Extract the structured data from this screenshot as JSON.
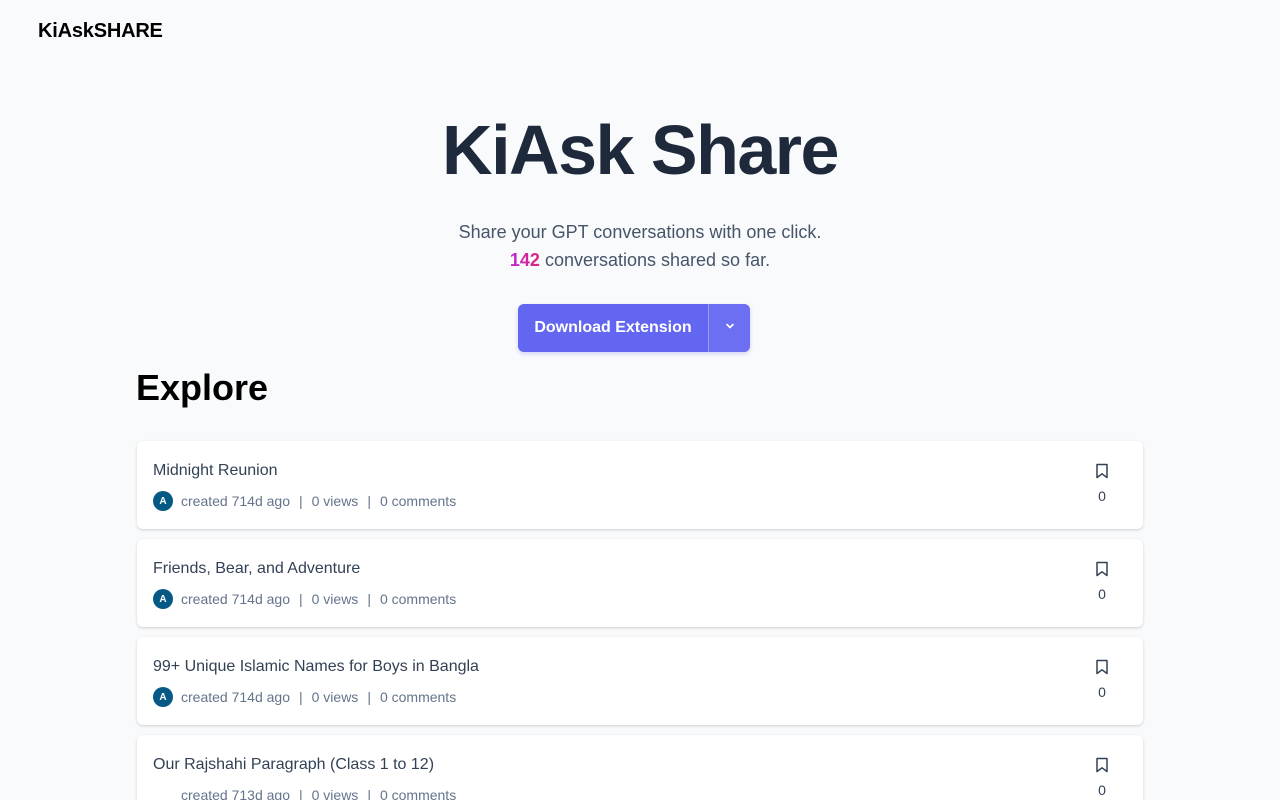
{
  "header": {
    "brand": "KiAskSHARE"
  },
  "hero": {
    "title": "KiAsk Share",
    "subtitle": "Share your GPT conversations with one click.",
    "count": "142",
    "count_suffix": " conversations shared so far.",
    "download_label": "Download Extension",
    "toggle_icon": "chevron-down-icon"
  },
  "explore": {
    "title": "Explore",
    "items": [
      {
        "title": "Midnight Reunion",
        "avatar": "A",
        "created": "created 714d ago",
        "views": "0 views",
        "comments": "0 comments",
        "bookmarks": "0"
      },
      {
        "title": "Friends, Bear, and Adventure",
        "avatar": "A",
        "created": "created 714d ago",
        "views": "0 views",
        "comments": "0 comments",
        "bookmarks": "0"
      },
      {
        "title": "99+ Unique Islamic Names for Boys in Bangla",
        "avatar": "A",
        "created": "created 714d ago",
        "views": "0 views",
        "comments": "0 comments",
        "bookmarks": "0"
      },
      {
        "title": "Our Rajshahi Paragraph (Class 1 to 12)",
        "avatar": "",
        "created": "created 713d ago",
        "views": "0 views",
        "comments": "0 comments",
        "bookmarks": "0"
      }
    ],
    "separator": "|"
  },
  "colors": {
    "accent": "#6366f1",
    "avatar_bg": "#075985",
    "count_gradient_start": "#c026d3",
    "count_gradient_end": "#db2777"
  }
}
